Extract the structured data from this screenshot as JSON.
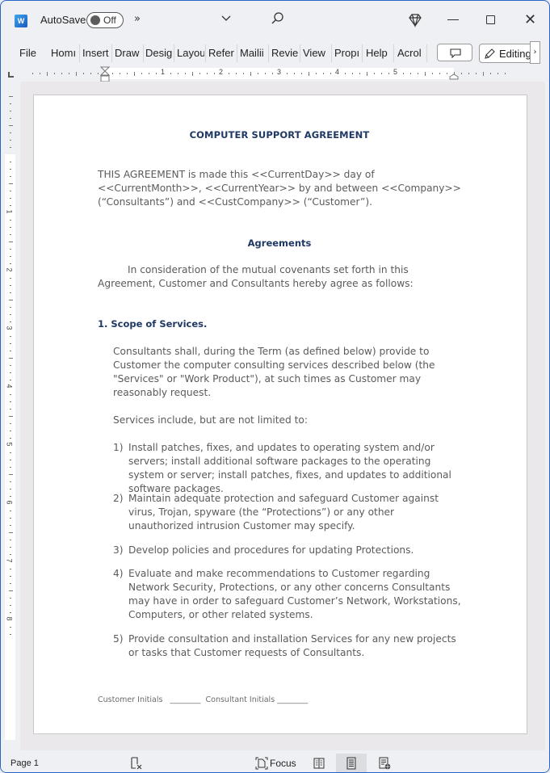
{
  "app": {
    "name": "Word",
    "autosave_label": "AutoSave",
    "autosave_state": "Off",
    "more_commands": "»"
  },
  "ribbon": {
    "tabs": [
      {
        "label": "File"
      },
      {
        "label": "Home"
      },
      {
        "label": "Insert"
      },
      {
        "label": "Draw"
      },
      {
        "label": "Design"
      },
      {
        "label": "Layout"
      },
      {
        "label": "References"
      },
      {
        "label": "Mailings"
      },
      {
        "label": "Review"
      },
      {
        "label": "View"
      },
      {
        "label": "Properties"
      },
      {
        "label": "Help"
      },
      {
        "label": "Acrobat"
      }
    ],
    "tabs_visible": [
      "File",
      "Homı",
      "Insert",
      "Draw",
      "Desig",
      "Layou",
      "Refer",
      "Mailii",
      "Revie",
      "View",
      "Propı",
      "Help",
      "Acrol"
    ],
    "editing_label": "Editing"
  },
  "rulers": {
    "horizontal_numbers": [
      "1",
      "2",
      "3",
      "4",
      "5"
    ],
    "vertical_numbers": [
      "1",
      "2",
      "3",
      "4",
      "5",
      "6",
      "7",
      "8"
    ]
  },
  "document": {
    "title": "COMPUTER SUPPORT AGREEMENT",
    "intro": "THIS AGREEMENT is made this <<CurrentDay>> day of <<CurrentMonth>>, <<CurrentYear>> by and between <<Company>> (“Consultants”) and <<CustCompany>> (“Customer”).",
    "agreements_heading": "Agreements",
    "consideration": "In consideration of the mutual covenants set forth in this Agreement, Customer and Consultants hereby agree as follows:",
    "section1_heading": "1. Scope of Services.",
    "scope_paragraph": "Consultants shall, during the Term (as defined below) provide to Customer the computer consulting services described below (the \"Services\" or \"Work Product\"), at such times as Customer may reasonably request.",
    "services_intro": "Services include, but are not limited to:",
    "services_list": [
      {
        "num": "1)",
        "text": "Install patches, fixes, and updates to operating system and/or servers; install additional software packages to the operating system or server; install patches, fixes, and updates to additional software packages."
      },
      {
        "num": "2)",
        "text": "Maintain adequate protection and safeguard Customer against virus, Trojan, spyware (the “Protections”) or any other unauthorized intrusion Customer may specify."
      },
      {
        "num": "3)",
        "text": "Develop policies and procedures for updating Protections."
      },
      {
        "num": "4)",
        "text": "Evaluate and make recommendations to Customer regarding Network Security, Protections, or any other concerns Consultants may have in order to safeguard Customer’s Network, Workstations, Computers, or other related systems."
      },
      {
        "num": "5)",
        "text": "Provide consultation and installation Services for any new projects or tasks that Customer requests of Consultants."
      }
    ],
    "footer_customer": "Customer Initials",
    "footer_blank1": "________",
    "footer_consultant": "Consultant Initials",
    "footer_blank2": "________"
  },
  "statusbar": {
    "page": "Page 1",
    "focus_label": "Focus"
  },
  "colors": {
    "heading": "#1f3864",
    "body_text": "#5b5b5b",
    "window_border": "#2a63c7",
    "word_brand": "#185abd"
  }
}
